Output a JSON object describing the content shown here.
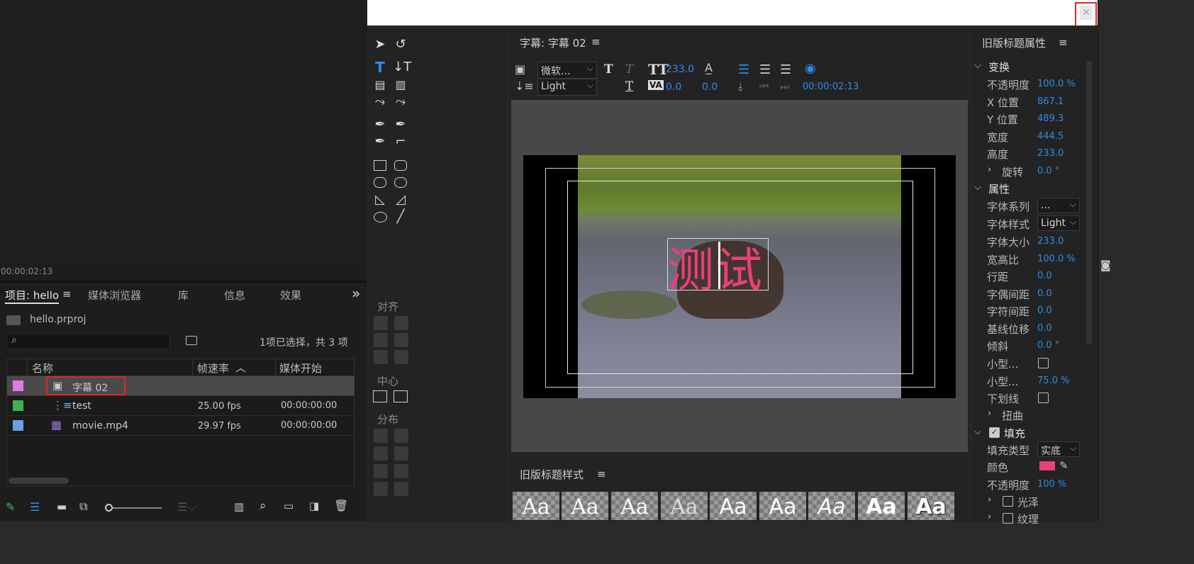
{
  "source_monitor": {
    "timecode": "00:00:02:13"
  },
  "project_panel": {
    "tabs": [
      "项目: hello",
      "媒体浏览器",
      "库",
      "信息",
      "效果"
    ],
    "more_label": "»",
    "file": "hello.prproj",
    "search_placeholder": "",
    "selection_status": "1项已选择，共 3 项",
    "columns": {
      "name": "名称",
      "fps": "帧速率",
      "start": "媒体开始"
    },
    "items": [
      {
        "name": "字幕 02",
        "fps": "",
        "start": "",
        "color": "#e07ae0"
      },
      {
        "name": "test",
        "fps": "25.00 fps",
        "start": "00:00:00:00",
        "color": "#3fb04f"
      },
      {
        "name": "movie.mp4",
        "fps": "29.97 fps",
        "start": "00:00:00:00",
        "color": "#6a9fe0"
      }
    ]
  },
  "title_editor": {
    "title": "字幕: 字幕 02",
    "font_family": "微软...",
    "font_style": "Light",
    "font_size": "233.0",
    "kerning": "0.0",
    "tracking": "0.0",
    "timecode": "00:00:02:13",
    "canvas_text": "测试",
    "sections": {
      "align": "对齐",
      "center": "中心",
      "distribute": "分布"
    }
  },
  "styles_panel": {
    "title": "旧版标题样式",
    "tiles": [
      "Aa",
      "Aa",
      "Aa",
      "Aa",
      "Aa",
      "Aa",
      "Aa",
      "Aa",
      "Aa"
    ]
  },
  "properties_panel": {
    "title": "旧版标题属性",
    "transform": {
      "header": "变换",
      "opacity_label": "不透明度",
      "opacity": "100.0 %",
      "x_label": "X 位置",
      "x": "867.1",
      "y_label": "Y 位置",
      "y": "489.3",
      "width_label": "宽度",
      "width": "444.5",
      "height_label": "高度",
      "height": "233.0",
      "rotation_label": "旋转",
      "rotation": "0.0 °"
    },
    "properties": {
      "header": "属性",
      "font_family_label": "字体系列",
      "font_family": "...",
      "font_style_label": "字体样式",
      "font_style": "Light",
      "font_size_label": "字体大小",
      "font_size": "233.0",
      "aspect_label": "宽高比",
      "aspect": "100.0 %",
      "leading_label": "行距",
      "leading": "0.0",
      "kerning_label": "字偶间距",
      "kerning": "0.0",
      "tracking_label": "字符间距",
      "tracking": "0.0",
      "baseline_label": "基线位移",
      "baseline": "0.0",
      "slant_label": "倾斜",
      "slant": "0.0 °",
      "smallcaps_label": "小型...",
      "smallcaps_size_label": "小型...",
      "smallcaps_size": "75.0 %",
      "underline_label": "下划线",
      "distort_label": "扭曲"
    },
    "fill": {
      "header": "填充",
      "type_label": "填充类型",
      "type": "实底",
      "color_label": "颜色",
      "color": "#e8407a",
      "opacity_label": "不透明度",
      "opacity": "100 %",
      "sheen_label": "光泽",
      "texture_label": "纹理"
    }
  }
}
